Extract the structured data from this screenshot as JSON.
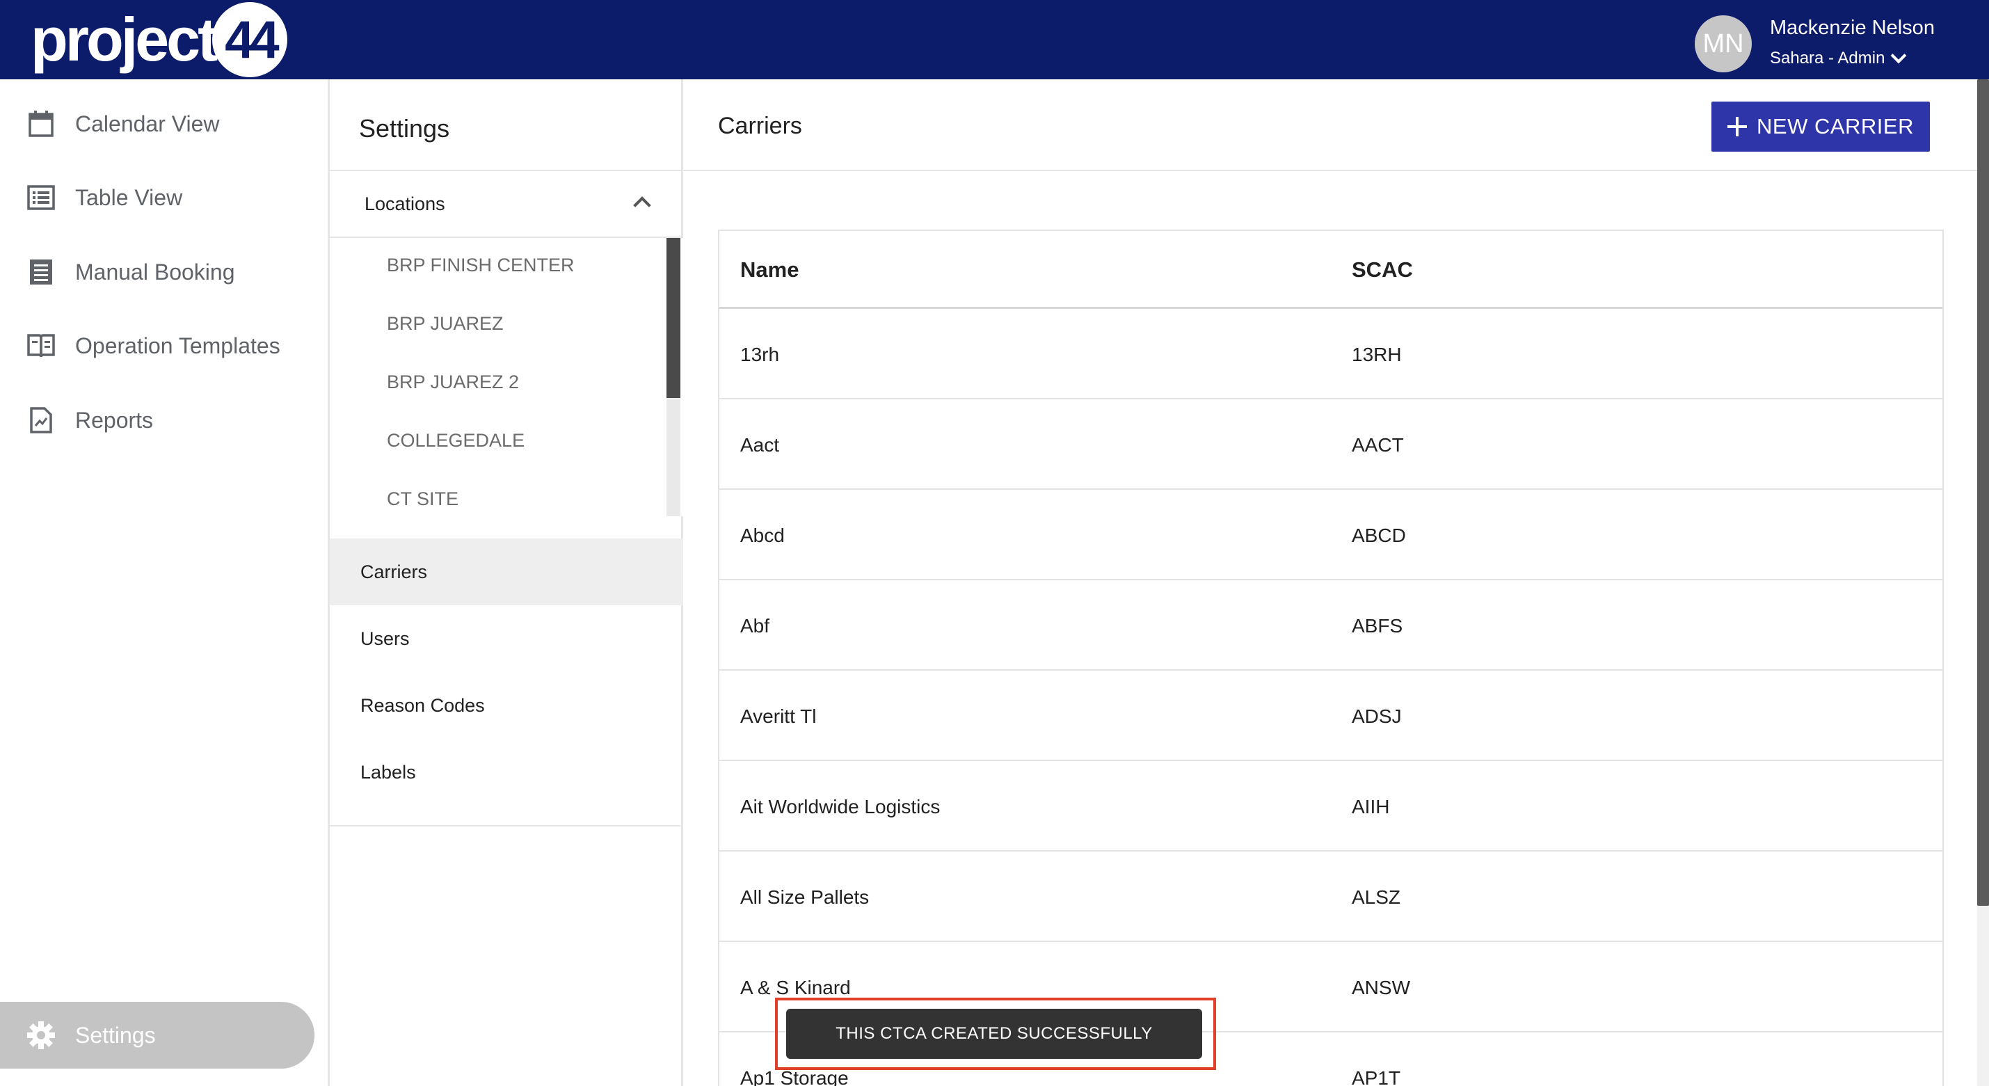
{
  "app": {
    "logo_text": "project",
    "logo_number": "44"
  },
  "user": {
    "initials": "MN",
    "name": "Mackenzie Nelson",
    "role": "Sahara - Admin"
  },
  "leftnav": {
    "items": [
      {
        "label": "Calendar View",
        "icon": "calendar-icon"
      },
      {
        "label": "Table View",
        "icon": "list-icon"
      },
      {
        "label": "Manual Booking",
        "icon": "form-icon"
      },
      {
        "label": "Operation Templates",
        "icon": "book-icon"
      },
      {
        "label": "Reports",
        "icon": "report-icon"
      }
    ],
    "settings_label": "Settings",
    "settings_icon": "gear-icon"
  },
  "settings": {
    "title": "Settings",
    "locations_label": "Locations",
    "locations": [
      "BRP FINISH CENTER",
      "BRP JUAREZ",
      "BRP JUAREZ 2",
      "COLLEGEDALE",
      "CT SITE"
    ],
    "items": [
      "Carriers",
      "Users",
      "Reason Codes",
      "Labels"
    ],
    "active": "Carriers"
  },
  "main": {
    "title": "Carriers",
    "new_button_label": "NEW CARRIER",
    "columns": [
      "Name",
      "SCAC"
    ],
    "rows": [
      {
        "name": "13rh",
        "scac": "13RH"
      },
      {
        "name": "Aact",
        "scac": "AACT"
      },
      {
        "name": "Abcd",
        "scac": "ABCD"
      },
      {
        "name": "Abf",
        "scac": "ABFS"
      },
      {
        "name": "Averitt Tl",
        "scac": "ADSJ"
      },
      {
        "name": "Ait Worldwide Logistics",
        "scac": "AIIH"
      },
      {
        "name": "All Size Pallets",
        "scac": "ALSZ"
      },
      {
        "name": "A & S Kinard",
        "scac": "ANSW"
      },
      {
        "name": "Ap1 Storage",
        "scac": "AP1T"
      }
    ]
  },
  "toast": {
    "message": "THIS CTCA CREATED SUCCESSFULLY"
  },
  "colors": {
    "topbar": "#0d1b6b",
    "primary_button": "#2e35a8",
    "toast_bg": "#333333",
    "highlight_outline": "#e0402a"
  }
}
